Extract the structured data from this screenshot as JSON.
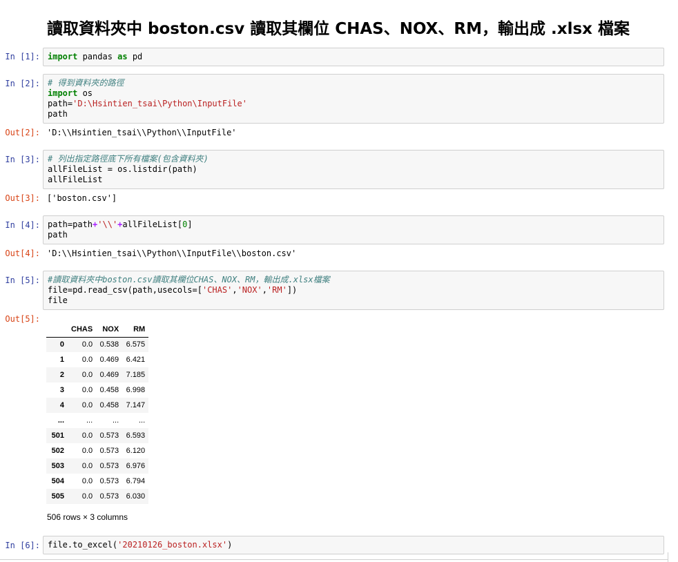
{
  "title": "讀取資料夾中 boston.csv 讀取其欄位 CHAS、NOX、RM，輸出成 .xlsx 檔案",
  "cells": [
    {
      "in_prompt": "In [1]:"
    },
    {
      "in_prompt": "In [2]:",
      "out_prompt": "Out[2]:",
      "output": "'D:\\\\Hsintien_tsai\\\\Python\\\\InputFile'"
    },
    {
      "in_prompt": "In [3]:",
      "out_prompt": "Out[3]:",
      "output": "['boston.csv']"
    },
    {
      "in_prompt": "In [4]:",
      "out_prompt": "Out[4]:",
      "output": "'D:\\\\Hsintien_tsai\\\\Python\\\\InputFile\\\\boston.csv'"
    },
    {
      "in_prompt": "In [5]:",
      "out_prompt": "Out[5]:"
    },
    {
      "in_prompt": "In [6]:"
    }
  ],
  "code": {
    "c1": {
      "k_import": "import",
      "t_pandas": " pandas ",
      "k_as": "as",
      "t_pd": " pd"
    },
    "c2": {
      "comment": "# 得到資料夾的路徑",
      "k_import": "import",
      "t_os": " os",
      "t_path_eq": "path=",
      "s_path": "'D:\\Hsintien_tsai\\Python\\InputFile'",
      "t_path": "path"
    },
    "c3": {
      "comment": "# 列出指定路徑底下所有檔案(包含資料夾)",
      "line2": "allFileList = os.listdir(path)",
      "line3": "allFileList"
    },
    "c4": {
      "t_a": "path=path",
      "o_plus1": "+",
      "s_sep": "'\\\\'",
      "o_plus2": "+",
      "t_b": "allFileList[",
      "n_zero": "0",
      "t_c": "]",
      "line2": "path"
    },
    "c5": {
      "comment": "#讀取資料夾中boston.csv讀取其欄位CHAS、NOX、RM，輸出成.xlsx檔案",
      "t_a": "file=pd.read_csv(path,usecols=[",
      "s_chas": "'CHAS'",
      "t_comma1": ",",
      "s_nox": "'NOX'",
      "t_comma2": ",",
      "s_rm": "'RM'",
      "t_b": "])",
      "line3": "file"
    },
    "c6": {
      "t_a": "file.to_excel(",
      "s_file": "'20210126_boston.xlsx'",
      "t_b": ")"
    }
  },
  "dataframe": {
    "columns": [
      "CHAS",
      "NOX",
      "RM"
    ],
    "rows": [
      {
        "index": "0",
        "CHAS": "0.0",
        "NOX": "0.538",
        "RM": "6.575"
      },
      {
        "index": "1",
        "CHAS": "0.0",
        "NOX": "0.469",
        "RM": "6.421"
      },
      {
        "index": "2",
        "CHAS": "0.0",
        "NOX": "0.469",
        "RM": "7.185"
      },
      {
        "index": "3",
        "CHAS": "0.0",
        "NOX": "0.458",
        "RM": "6.998"
      },
      {
        "index": "4",
        "CHAS": "0.0",
        "NOX": "0.458",
        "RM": "7.147"
      },
      {
        "index": "...",
        "CHAS": "...",
        "NOX": "...",
        "RM": "..."
      },
      {
        "index": "501",
        "CHAS": "0.0",
        "NOX": "0.573",
        "RM": "6.593"
      },
      {
        "index": "502",
        "CHAS": "0.0",
        "NOX": "0.573",
        "RM": "6.120"
      },
      {
        "index": "503",
        "CHAS": "0.0",
        "NOX": "0.573",
        "RM": "6.976"
      },
      {
        "index": "504",
        "CHAS": "0.0",
        "NOX": "0.573",
        "RM": "6.794"
      },
      {
        "index": "505",
        "CHAS": "0.0",
        "NOX": "0.573",
        "RM": "6.030"
      }
    ],
    "shape": "506 rows × 3 columns"
  },
  "colors": {
    "in_prompt": "#303f9f",
    "out_prompt": "#d84315",
    "keyword": "#008000",
    "comment": "#408080",
    "string": "#ba2121",
    "operator": "#aa22ff",
    "cell_bg": "#f7f7f7",
    "cell_border": "#cfcfcf"
  }
}
